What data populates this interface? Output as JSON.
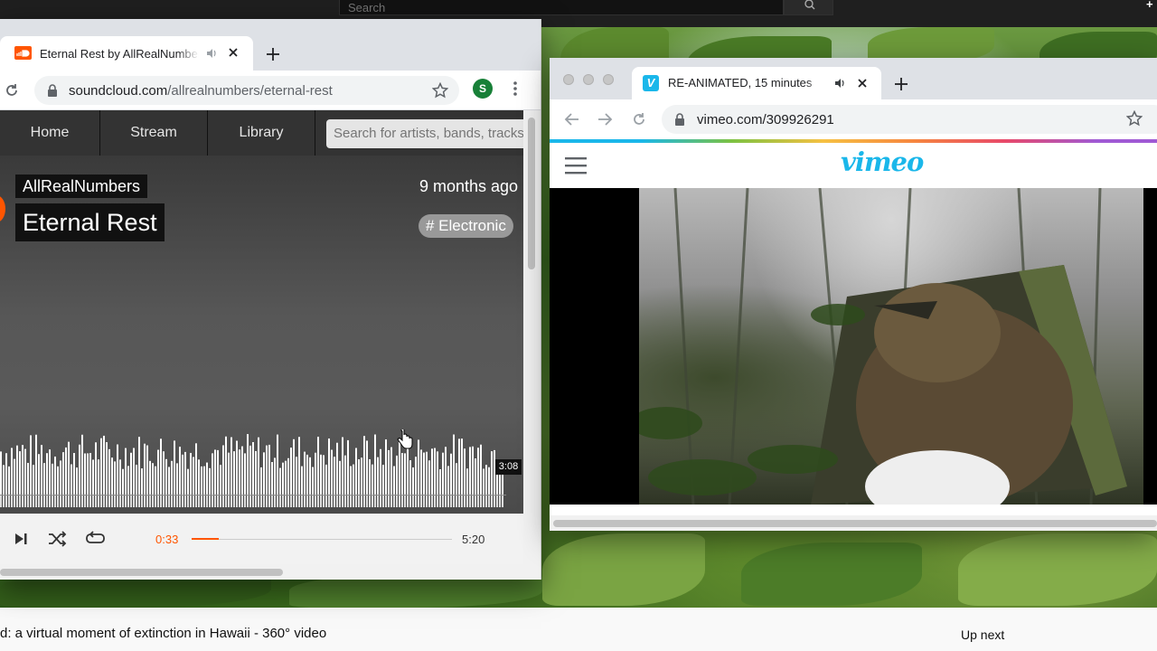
{
  "background": {
    "search_placeholder": "Search",
    "video_title": "d: a virtual moment of extinction in Hawaii - 360° video",
    "up_next": "Up next"
  },
  "left_window": {
    "tab_title": "Eternal Rest by AllRealNumbers",
    "url_host": "soundcloud.com",
    "url_path": "/allrealnumbers/eternal-rest",
    "profile_initial": "S",
    "nav": {
      "home": "Home",
      "stream": "Stream",
      "library": "Library",
      "search_placeholder": "Search for artists, bands, tracks, podcasts"
    },
    "track": {
      "artist": "AllRealNumbers",
      "title": "Eternal Rest",
      "posted": "9 months ago",
      "tag": "# Electronic",
      "hover_time": "3:08"
    },
    "player": {
      "elapsed": "0:33",
      "total": "5:20",
      "progress_fraction": 0.103
    },
    "accent": "#ff5500"
  },
  "right_window": {
    "tab_title": "RE-ANIMATED, 15 minutes",
    "favicon_letter": "V",
    "url": "vimeo.com/309926291",
    "logo": "vimeo",
    "accent": "#1ab7ea"
  }
}
